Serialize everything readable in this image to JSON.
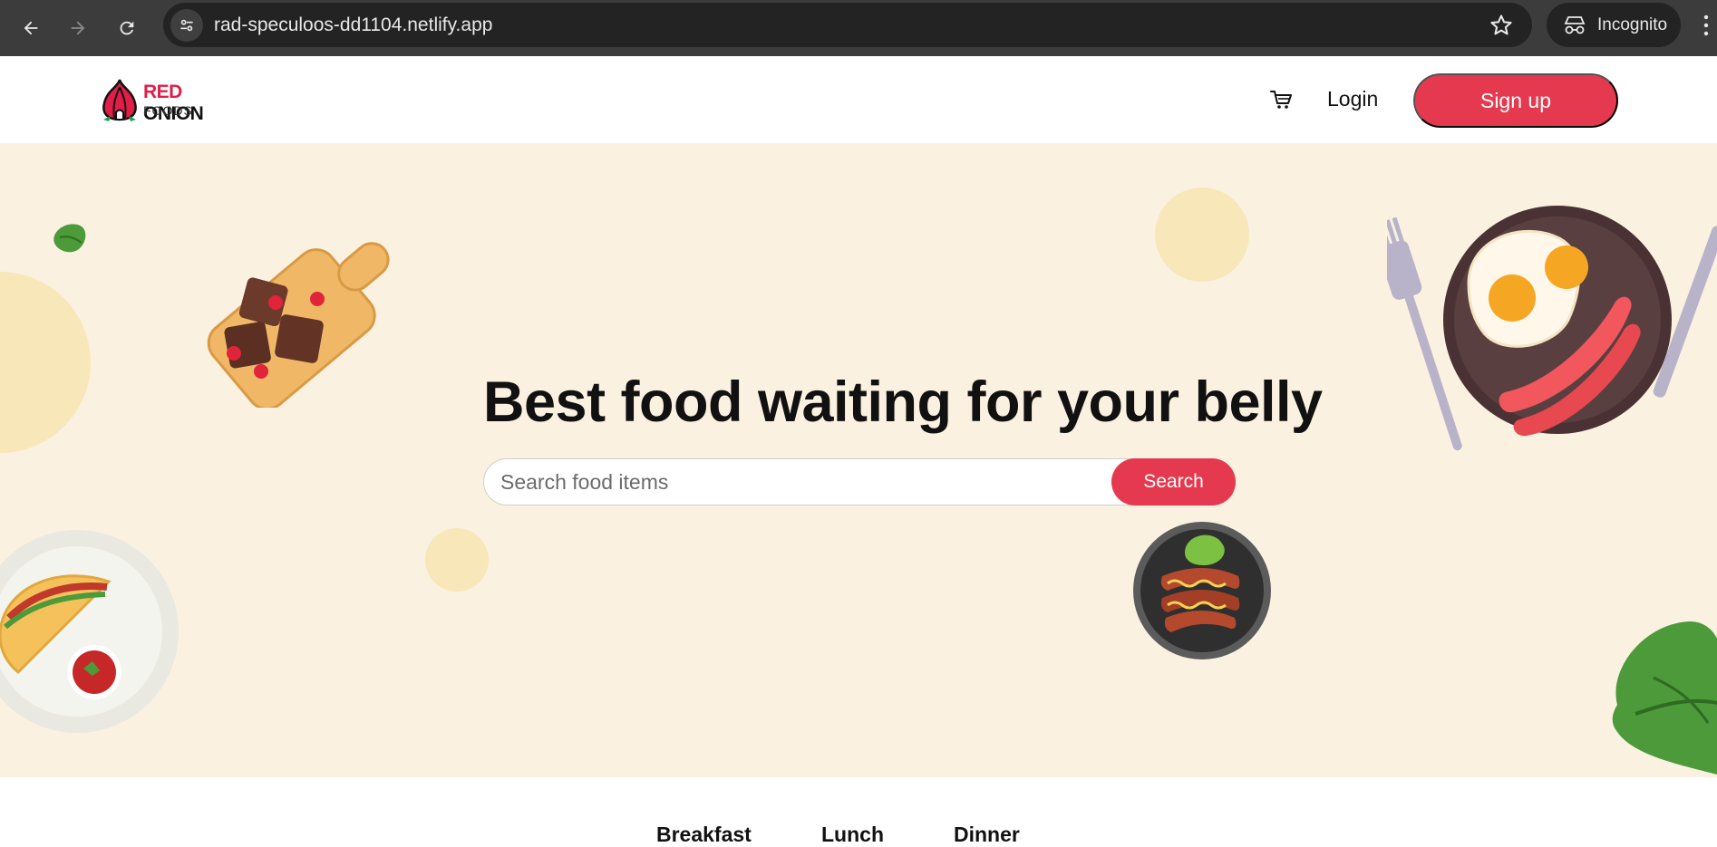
{
  "browser": {
    "url": "rad-speculoos-dd1104.netlify.app",
    "incognito_label": "Incognito"
  },
  "brand": {
    "name_red": "RED",
    "name_black": "ONION",
    "sub": "FOODS",
    "accent_color": "#e5394f"
  },
  "nav": {
    "login_label": "Login",
    "signup_label": "Sign up"
  },
  "hero": {
    "title": "Best food waiting for your belly",
    "search_placeholder": "Search food items",
    "search_button": "Search",
    "background_color": "#fbf1e1"
  },
  "tabs": [
    {
      "label": "Breakfast"
    },
    {
      "label": "Lunch"
    },
    {
      "label": "Dinner"
    }
  ]
}
